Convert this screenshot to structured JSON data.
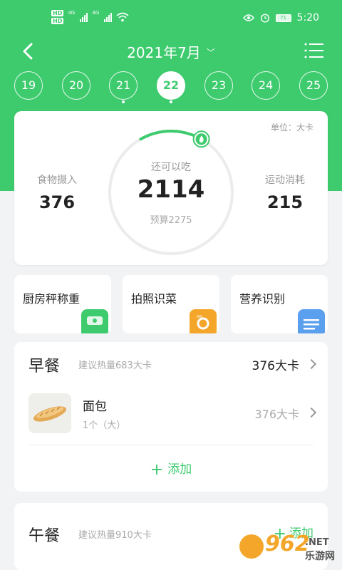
{
  "status_bar": {
    "hd_top": "HD",
    "hd_bottom": "HD",
    "net1": "4G",
    "net2": "4G",
    "battery": "71",
    "time": "5:20"
  },
  "header": {
    "title": "2021年7月"
  },
  "days": [
    {
      "label": "19",
      "selected": false,
      "dot": false
    },
    {
      "label": "20",
      "selected": false,
      "dot": false
    },
    {
      "label": "21",
      "selected": false,
      "dot": true
    },
    {
      "label": "22",
      "selected": true,
      "dot": true
    },
    {
      "label": "23",
      "selected": false,
      "dot": false
    },
    {
      "label": "24",
      "selected": false,
      "dot": false
    },
    {
      "label": "25",
      "selected": false,
      "dot": false
    }
  ],
  "summary": {
    "unit": "单位：大卡",
    "intake_label": "食物摄入",
    "intake_value": "376",
    "remaining_label": "还可以吃",
    "remaining_value": "2114",
    "budget_text": "预算2275",
    "exercise_label": "运动消耗",
    "exercise_value": "215",
    "progress_fraction": 0.165
  },
  "tools": [
    {
      "label": "厨房秤称重",
      "icon": "scale-icon",
      "color": "#3dcb6e"
    },
    {
      "label": "拍照识菜",
      "icon": "camera-icon",
      "color": "#f4a62a"
    },
    {
      "label": "营养识别",
      "icon": "document-icon",
      "color": "#5aa0ee"
    }
  ],
  "breakfast": {
    "title": "早餐",
    "hint": "建议热量683大卡",
    "kcal": "376大卡",
    "food": {
      "name": "面包",
      "qty": "1个（大）",
      "kcal": "376大卡"
    },
    "add_label": "添加"
  },
  "lunch": {
    "title": "午餐",
    "hint": "建议热量910大卡",
    "add_label": "添加"
  },
  "watermark": {
    "number": "962",
    "net": ".NET",
    "cn": "乐游网"
  },
  "colors": {
    "brand_green": "#3dcb6e"
  }
}
